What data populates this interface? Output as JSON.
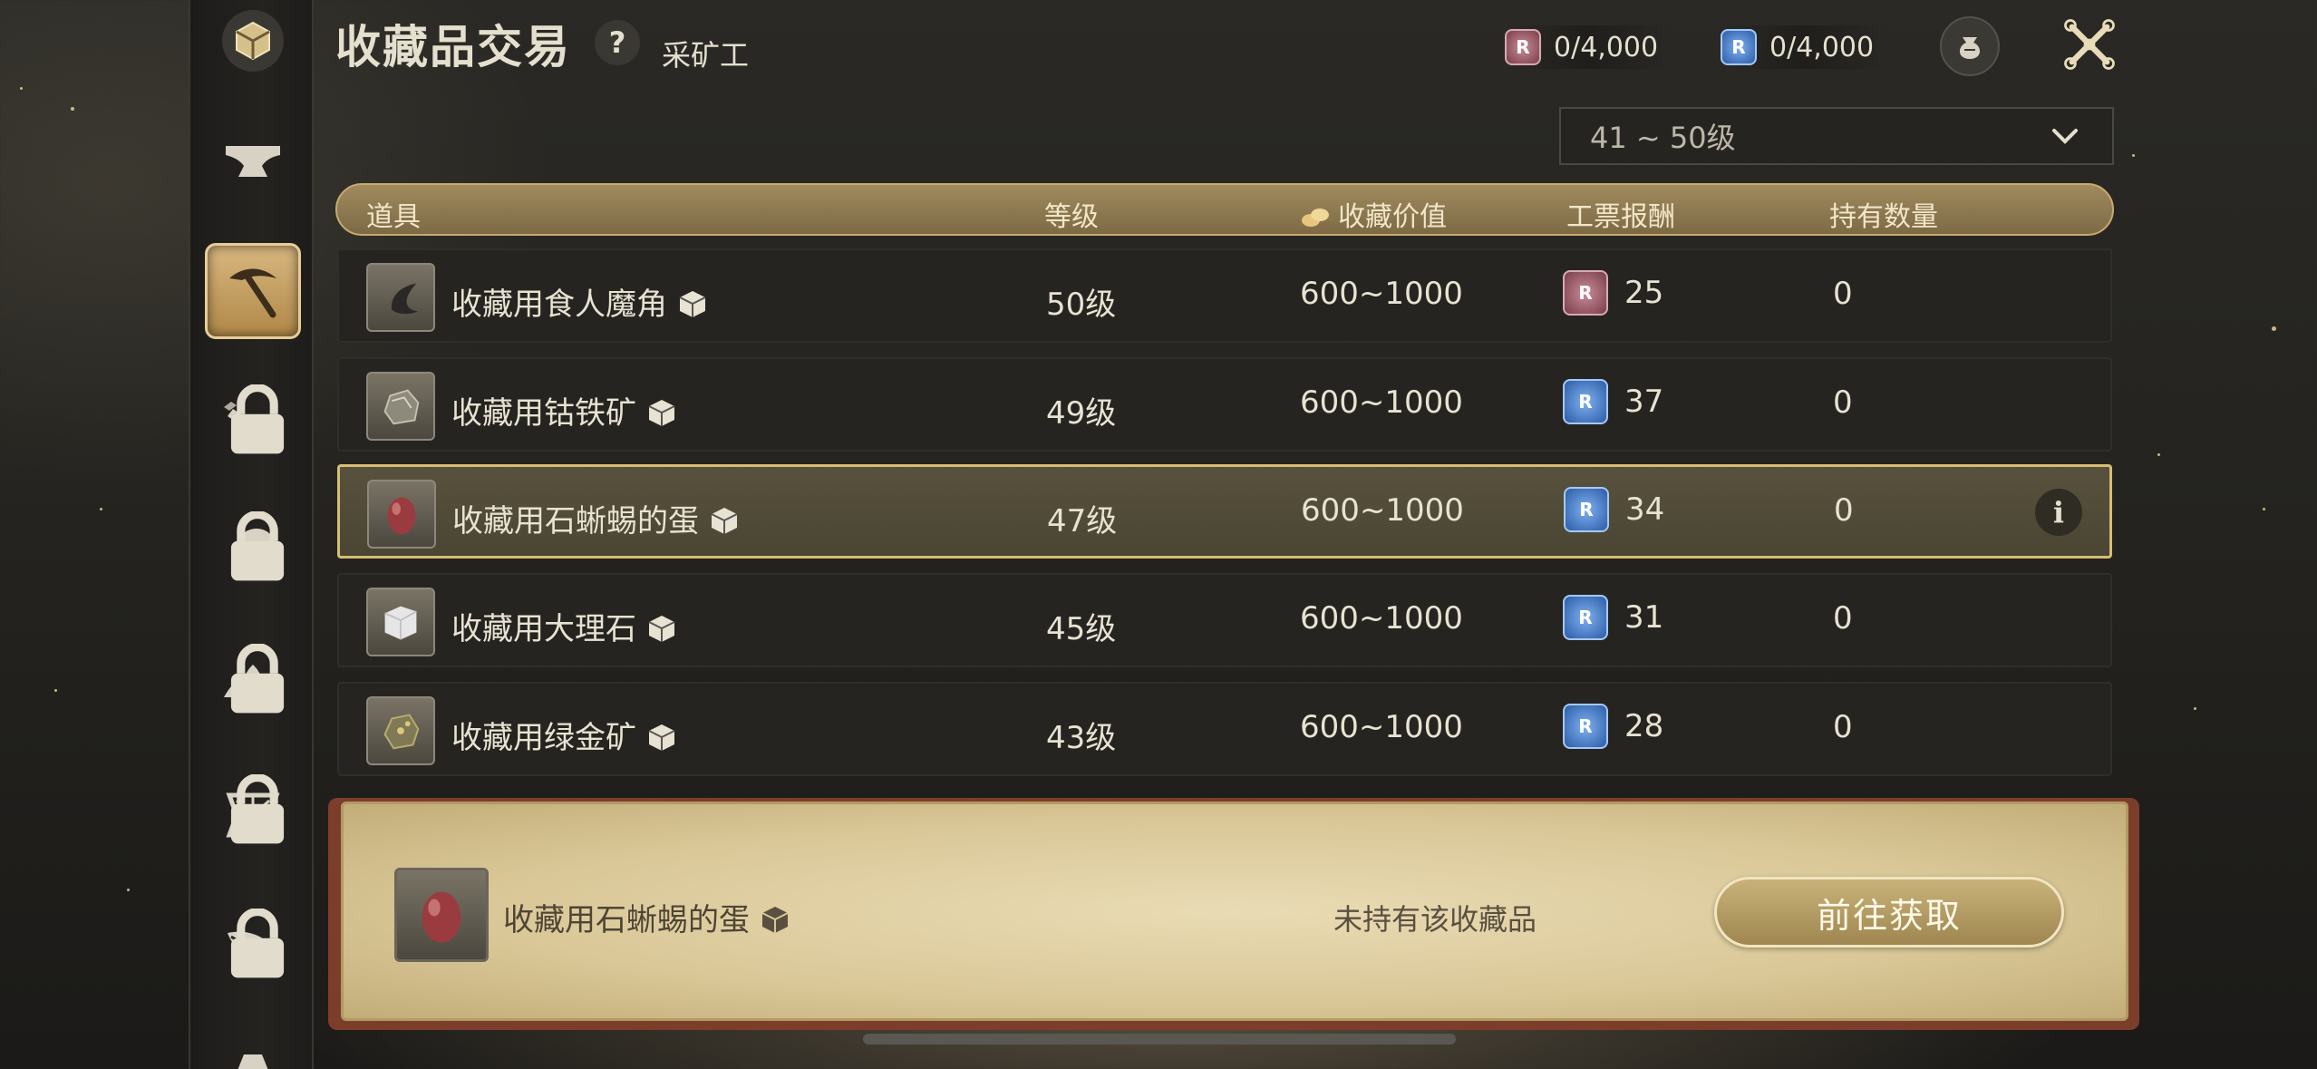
{
  "header": {
    "title": "收藏品交易",
    "help_label": "?",
    "subtitle": "采矿工",
    "currencies": [
      {
        "icon": "red-ticket-icon",
        "color": "#8c4a58",
        "value": "0/4,000"
      },
      {
        "icon": "blue-ticket-icon",
        "color": "#3a6fc0",
        "value": "0/4,000"
      }
    ]
  },
  "filter": {
    "selected": "41 ~ 50级"
  },
  "table": {
    "headers": [
      "道具",
      "等级",
      "收藏价值",
      "工票报酬",
      "持有数量"
    ],
    "rows": [
      {
        "name": "收藏用食人魔角",
        "level": "50级",
        "value": "600~1000",
        "reward_type": "red",
        "reward": "25",
        "held": "0",
        "selected": false
      },
      {
        "name": "收藏用钴铁矿",
        "level": "49级",
        "value": "600~1000",
        "reward_type": "blue",
        "reward": "37",
        "held": "0",
        "selected": false
      },
      {
        "name": "收藏用石蜥蜴的蛋",
        "level": "47级",
        "value": "600~1000",
        "reward_type": "blue",
        "reward": "34",
        "held": "0",
        "selected": true
      },
      {
        "name": "收藏用大理石",
        "level": "45级",
        "value": "600~1000",
        "reward_type": "blue",
        "reward": "31",
        "held": "0",
        "selected": false
      },
      {
        "name": "收藏用绿金矿",
        "level": "43级",
        "value": "600~1000",
        "reward_type": "blue",
        "reward": "28",
        "held": "0",
        "selected": false
      }
    ]
  },
  "detail": {
    "name": "收藏用石蜥蜴的蛋",
    "status": "未持有该收藏品",
    "button": "前往获取"
  },
  "info_label": "i",
  "ticket_glyph": "R"
}
